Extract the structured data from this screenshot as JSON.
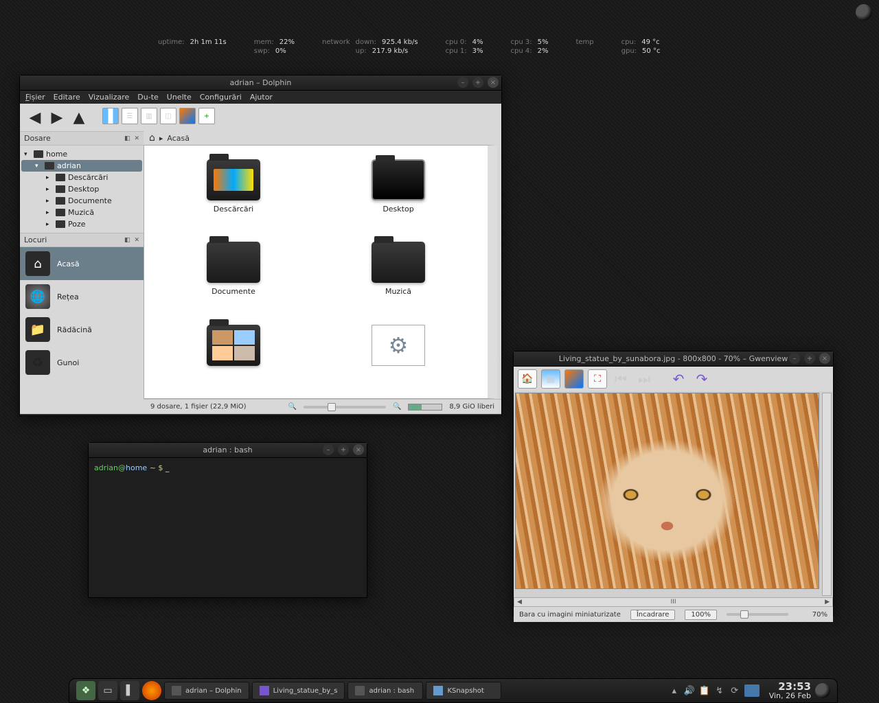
{
  "conky": {
    "uptime_label": "uptime:",
    "uptime": "2h 1m 11s",
    "mem_label": "mem:",
    "mem": "22%",
    "swp_label": "swp:",
    "swp": "0%",
    "network_label": "network",
    "down_label": "down:",
    "down": "925.4 kb/s",
    "up_label": "up:",
    "up": "217.9 kb/s",
    "cpu0_label": "cpu 0:",
    "cpu0": "4%",
    "cpu1_label": "cpu 1:",
    "cpu1": "3%",
    "cpu3_label": "cpu 3:",
    "cpu3": "5%",
    "cpu4_label": "cpu 4:",
    "cpu4": "2%",
    "temp_label": "temp",
    "tcpu_label": "cpu:",
    "tcpu": "49 °c",
    "tgpu_label": "gpu:",
    "tgpu": "50 °c"
  },
  "dolphin": {
    "title": "adrian – Dolphin",
    "menu": {
      "file": "Fișier",
      "edit": "Editare",
      "view": "Vizualizare",
      "go": "Du-te",
      "tools": "Unelte",
      "settings": "Configurări",
      "help": "Ajutor"
    },
    "panes": {
      "folders": "Dosare",
      "places": "Locuri"
    },
    "tree": {
      "home": "home",
      "adrian": "adrian",
      "downloads": "Descărcări",
      "desktop": "Desktop",
      "documents": "Documente",
      "music": "Muzică",
      "pictures": "Poze"
    },
    "places": {
      "home": "Acasă",
      "network": "Rețea",
      "root": "Rădăcină",
      "trash": "Gunoi"
    },
    "breadcrumb": "Acasă",
    "folders": {
      "downloads": "Descărcări",
      "desktop": "Desktop",
      "documents": "Documente",
      "music": "Muzică"
    },
    "status_left": "9 dosare, 1 fișier (22,9 MiO)",
    "status_right": "8,9 GiO liberi"
  },
  "terminal": {
    "title": "adrian : bash",
    "user": "adrian",
    "at": "@",
    "host": "home",
    "path": " ~ $ ",
    "cursor": "_"
  },
  "gwen": {
    "title": "Living_statue_by_sunabora.jpg - 800x800 - 70% – Gwenview",
    "thumbbar": "Bara cu imagini miniaturizate",
    "fit": "Încadrare",
    "zoom100": "100%",
    "zoomval": "70%",
    "scrollmark": "III"
  },
  "taskbar": {
    "t1": "adrian – Dolphin",
    "t2": "Living_statue_by_s",
    "t3": "adrian : bash",
    "t4": "KSnapshot",
    "time": "23:53",
    "date": "Vin, 26 Feb"
  }
}
